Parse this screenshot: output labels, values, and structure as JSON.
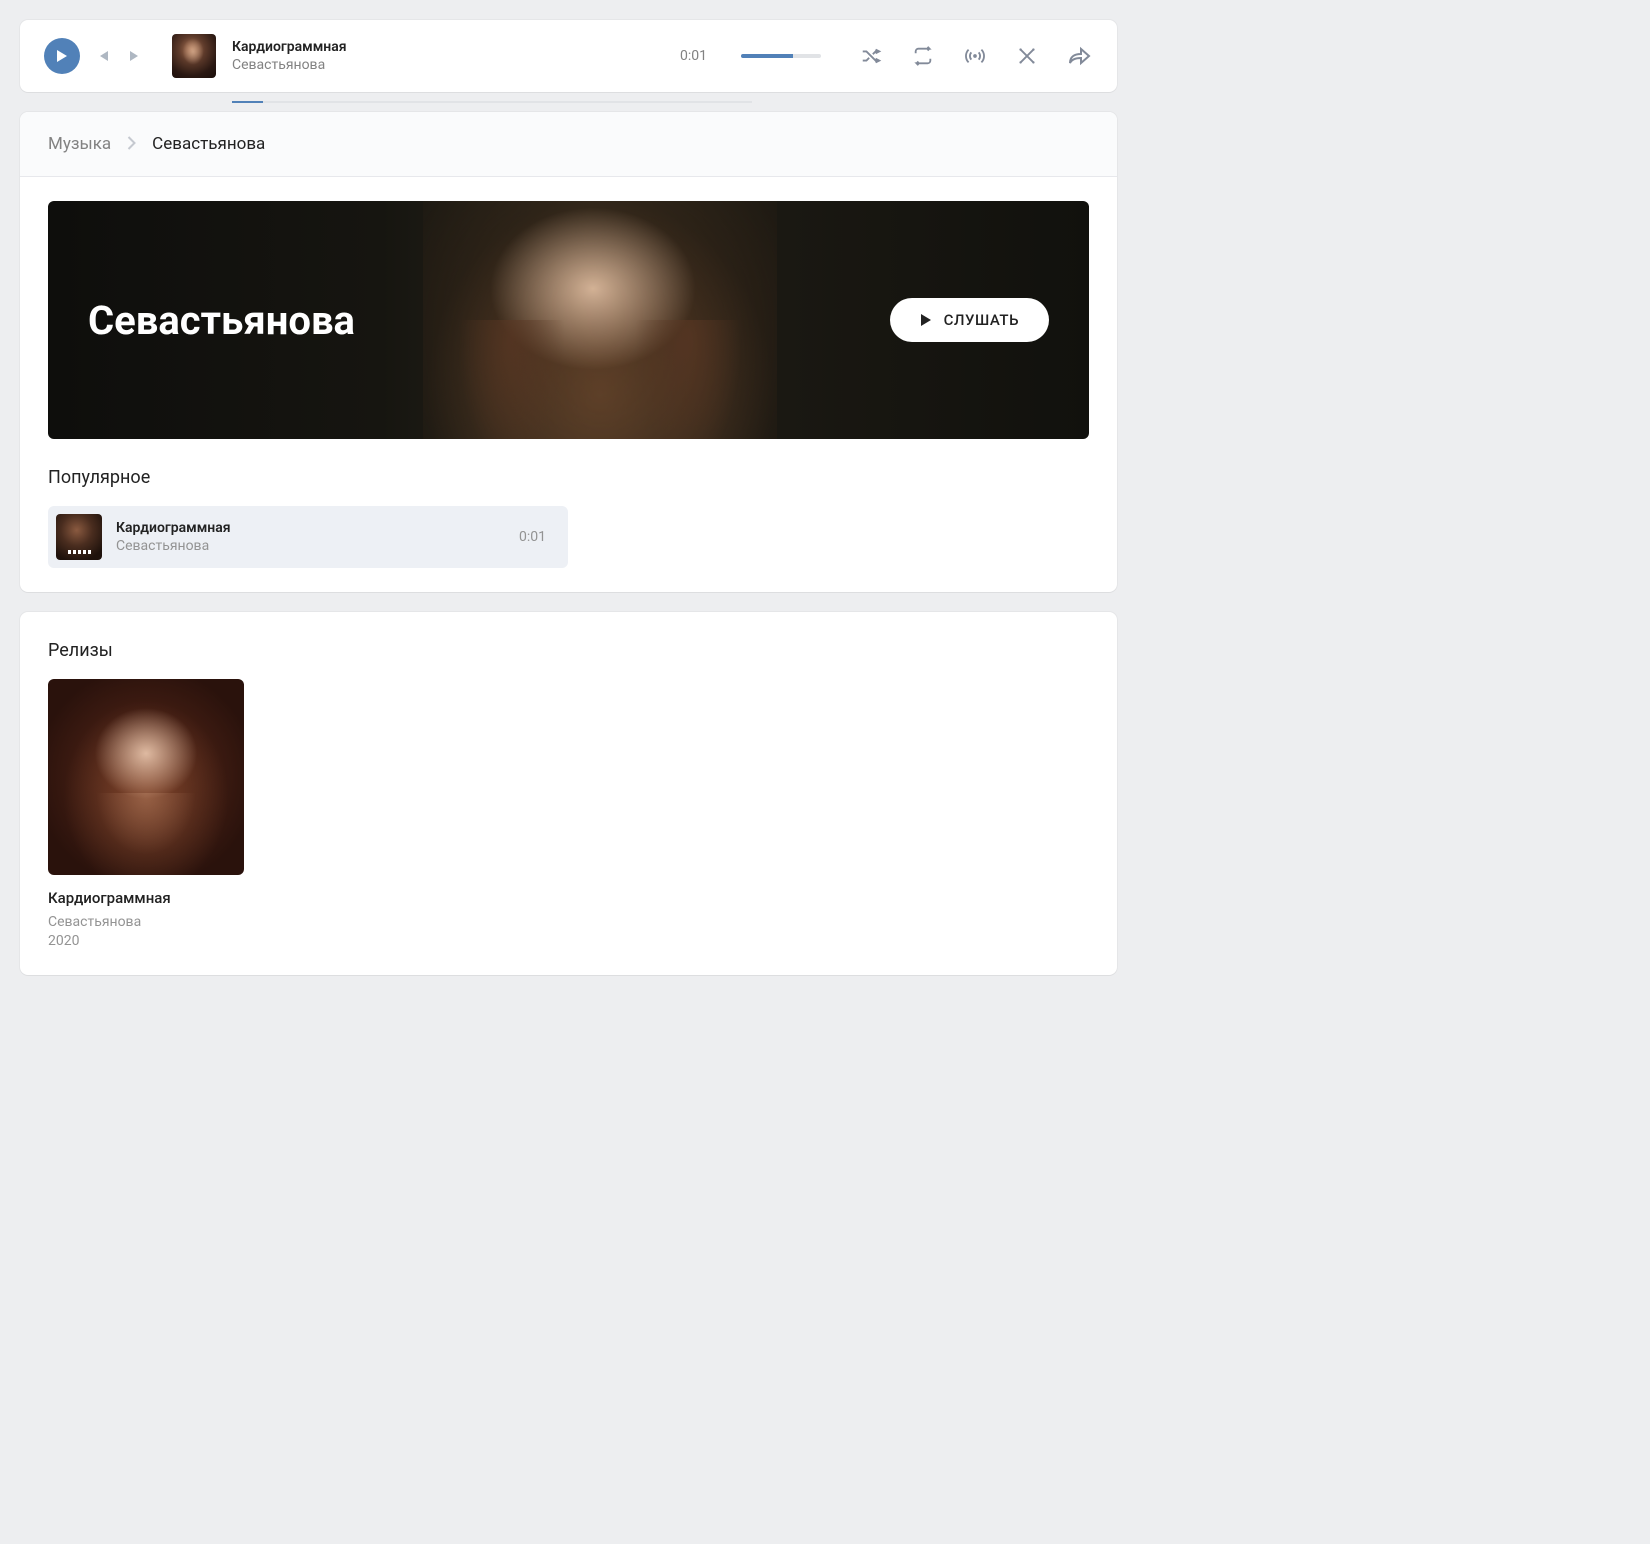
{
  "player": {
    "track_title": "Кардиограммная",
    "artist": "Севастьянова",
    "time": "0:01"
  },
  "breadcrumb": {
    "root": "Музыка",
    "current": "Севастьянова"
  },
  "hero": {
    "artist_name": "Севастьянова",
    "listen_label": "СЛУШАТЬ"
  },
  "popular": {
    "heading": "Популярное",
    "tracks": [
      {
        "title": "Кардиограммная",
        "artist": "Севастьянова",
        "duration": "0:01"
      }
    ]
  },
  "releases": {
    "heading": "Релизы",
    "items": [
      {
        "title": "Кардиограммная",
        "artist": "Севастьянова",
        "year": "2020"
      }
    ]
  }
}
